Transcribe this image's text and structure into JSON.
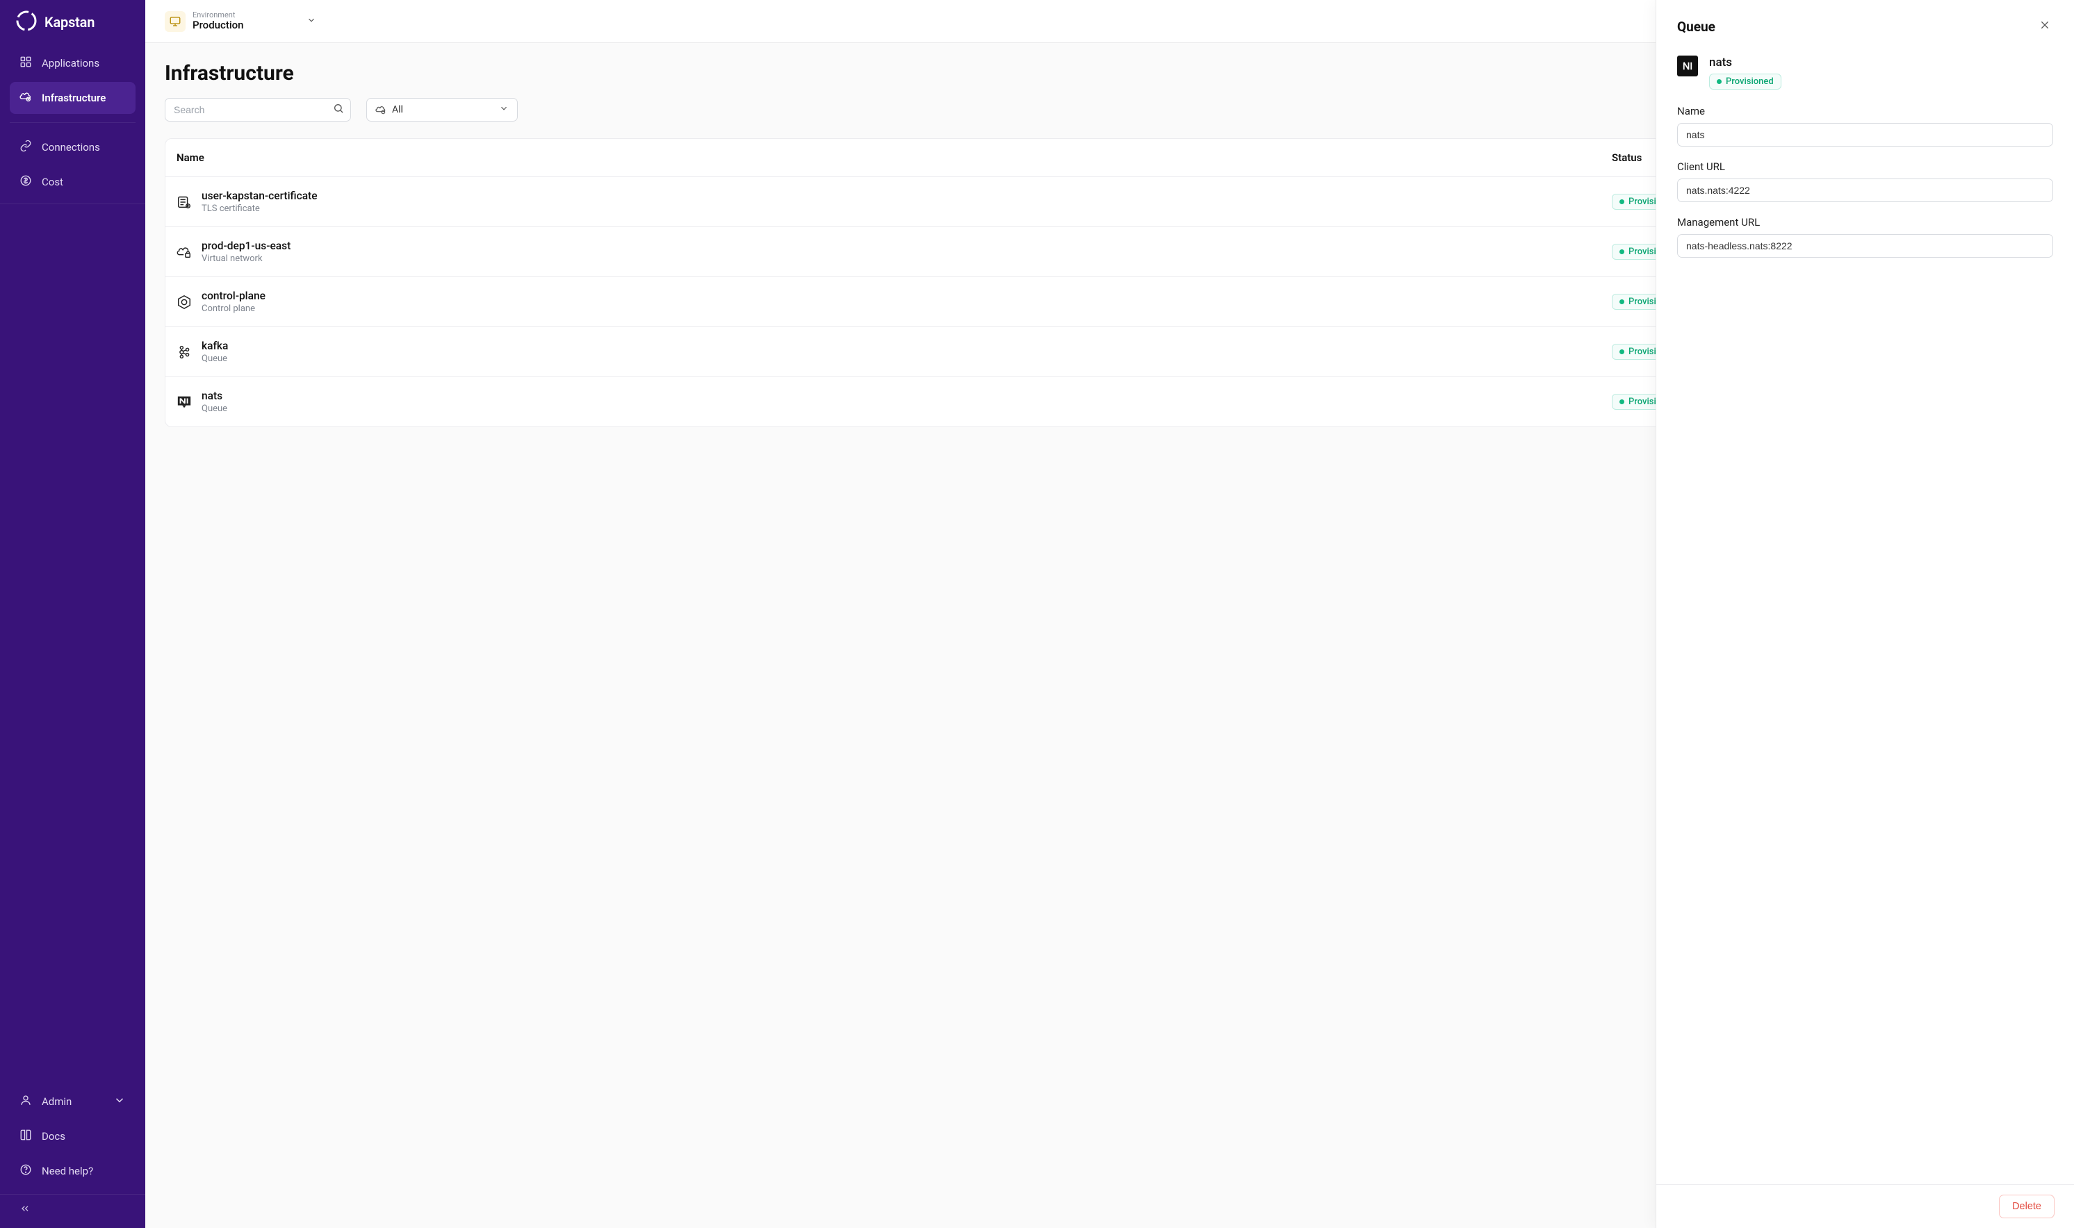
{
  "brand": {
    "name": "Kapstan"
  },
  "sidebar": {
    "items": [
      {
        "label": "Applications"
      },
      {
        "label": "Infrastructure"
      },
      {
        "label": "Connections"
      },
      {
        "label": "Cost"
      }
    ],
    "bottom": [
      {
        "label": "Admin"
      },
      {
        "label": "Docs"
      },
      {
        "label": "Need help?"
      }
    ]
  },
  "topbar": {
    "env_caption": "Environment",
    "env_value": "Production"
  },
  "page": {
    "title": "Infrastructure",
    "search_placeholder": "Search",
    "filter_value": "All"
  },
  "table": {
    "columns": {
      "name": "Name",
      "status": "Status"
    },
    "rows": [
      {
        "name": "user-kapstan-certificate",
        "sub": "TLS certificate",
        "status": "Provisioned"
      },
      {
        "name": "prod-dep1-us-east",
        "sub": "Virtual network",
        "status": "Provisioned"
      },
      {
        "name": "control-plane",
        "sub": "Control plane",
        "status": "Provisioned"
      },
      {
        "name": "kafka",
        "sub": "Queue",
        "status": "Provisioned"
      },
      {
        "name": "nats",
        "sub": "Queue",
        "status": "Provisioned"
      }
    ]
  },
  "drawer": {
    "title": "Queue",
    "name": "nats",
    "status": "Provisioned",
    "fields": {
      "name_label": "Name",
      "name_value": "nats",
      "client_url_label": "Client URL",
      "client_url_value": "nats.nats:4222",
      "mgmt_url_label": "Management URL",
      "mgmt_url_value": "nats-headless.nats:8222"
    },
    "delete_label": "Delete"
  }
}
